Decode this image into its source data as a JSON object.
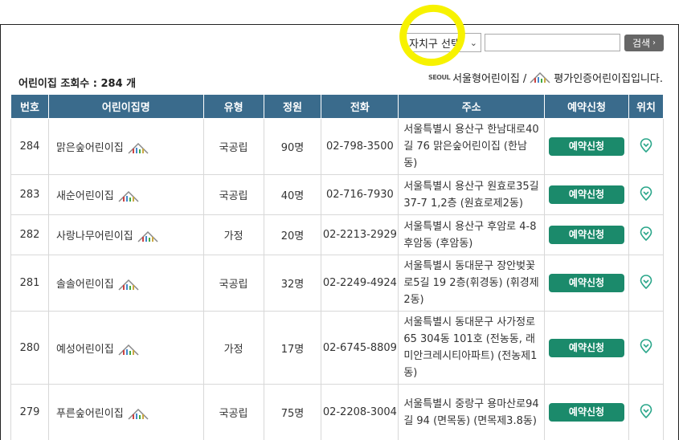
{
  "search": {
    "district_select": "자치구 선택",
    "input_value": "",
    "button_label": "검색"
  },
  "summary": {
    "count_label": "어린이집 조회수 : 284 개"
  },
  "legend": {
    "seoul_logo": "SEOUL",
    "text": "서울형어린이집 / ",
    "text2": "평가인증어린이집입니다."
  },
  "table": {
    "headers": [
      "번호",
      "어린이집명",
      "유형",
      "정원",
      "전화",
      "주소",
      "예약신청",
      "위치"
    ],
    "reserve_label": "예약신청",
    "rows": [
      {
        "no": "284",
        "name": "맑은숲어린이집",
        "type": "국공립",
        "cap": "90명",
        "tel": "02-798-3500",
        "addr": "서울특별시 용산구 한남대로40길 76 맑은숲어린이집 (한남동)"
      },
      {
        "no": "283",
        "name": "새순어린이집",
        "type": "국공립",
        "cap": "40명",
        "tel": "02-716-7930",
        "addr": "서울특별시 용산구 원효로35길 37-7 1,2층 (원효로제2동)"
      },
      {
        "no": "282",
        "name": "사랑나무어린이집",
        "type": "가정",
        "cap": "20명",
        "tel": "02-2213-2929",
        "addr": "서울특별시 용산구 후암로 4-8 후암동 (후암동)"
      },
      {
        "no": "281",
        "name": "솔솔어린이집",
        "type": "국공립",
        "cap": "32명",
        "tel": "02-2249-4924",
        "addr": "서울특별시 동대문구 장안벚꽃로5길 19 2층(휘경동) (휘경제2동)"
      },
      {
        "no": "280",
        "name": "예성어린이집",
        "type": "가정",
        "cap": "17명",
        "tel": "02-6745-8809",
        "addr": "서울특별시 동대문구 사가정로 65 304동 101호 (전농동, 래미안크레시티아파트) (전농제1동)"
      },
      {
        "no": "279",
        "name": "푸른숲어린이집",
        "type": "국공립",
        "cap": "75명",
        "tel": "02-2208-3004",
        "addr": "서울특별시 중랑구 용마산로94길 94 (면목동) (면목제3.8동)"
      }
    ]
  },
  "colors": {
    "header_bg": "#3a6b8c",
    "reserve_bg": "#1b8a6b",
    "pin": "#2aa68a",
    "highlight": "#f7f200"
  }
}
